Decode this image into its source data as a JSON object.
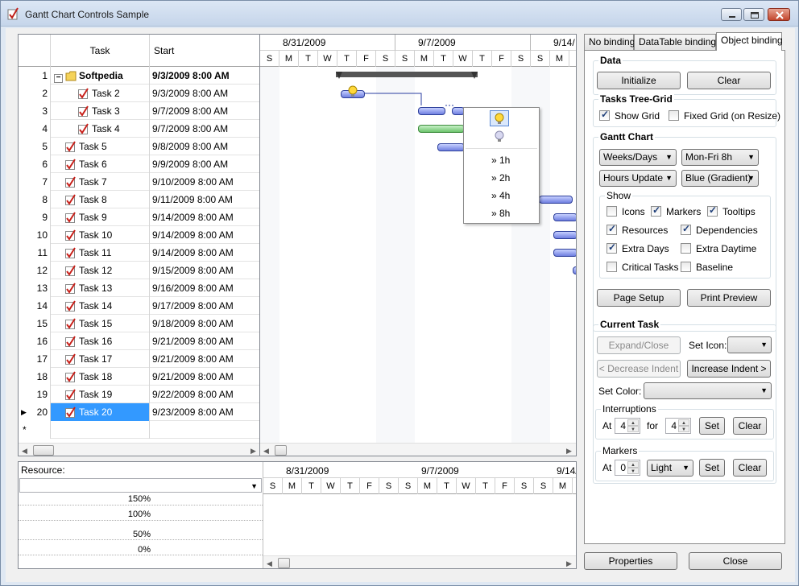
{
  "window": {
    "title": "Gantt Chart Controls Sample"
  },
  "grid": {
    "columns": [
      "Task",
      "Start"
    ],
    "rows": [
      {
        "num": "1",
        "task": "Softpedia",
        "start": "9/3/2009 8:00 AM",
        "bold": true,
        "icon": "folder"
      },
      {
        "num": "2",
        "task": "Task 2",
        "start": "9/3/2009 8:00 AM",
        "indent": 2
      },
      {
        "num": "3",
        "task": "Task 3",
        "start": "9/7/2009 8:00 AM",
        "indent": 2
      },
      {
        "num": "4",
        "task": "Task 4",
        "start": "9/7/2009 8:00 AM",
        "indent": 2
      },
      {
        "num": "5",
        "task": "Task 5",
        "start": "9/8/2009 8:00 AM"
      },
      {
        "num": "6",
        "task": "Task 6",
        "start": "9/9/2009 8:00 AM"
      },
      {
        "num": "7",
        "task": "Task 7",
        "start": "9/10/2009 8:00 AM"
      },
      {
        "num": "8",
        "task": "Task 8",
        "start": "9/11/2009 8:00 AM"
      },
      {
        "num": "9",
        "task": "Task 9",
        "start": "9/14/2009 8:00 AM"
      },
      {
        "num": "10",
        "task": "Task 10",
        "start": "9/14/2009 8:00 AM"
      },
      {
        "num": "11",
        "task": "Task 11",
        "start": "9/14/2009 8:00 AM"
      },
      {
        "num": "12",
        "task": "Task 12",
        "start": "9/15/2009 8:00 AM"
      },
      {
        "num": "13",
        "task": "Task 13",
        "start": "9/16/2009 8:00 AM"
      },
      {
        "num": "14",
        "task": "Task 14",
        "start": "9/17/2009 8:00 AM"
      },
      {
        "num": "15",
        "task": "Task 15",
        "start": "9/18/2009 8:00 AM"
      },
      {
        "num": "16",
        "task": "Task 16",
        "start": "9/21/2009 8:00 AM"
      },
      {
        "num": "17",
        "task": "Task 17",
        "start": "9/21/2009 8:00 AM"
      },
      {
        "num": "18",
        "task": "Task 18",
        "start": "9/21/2009 8:00 AM"
      },
      {
        "num": "19",
        "task": "Task 19",
        "start": "9/22/2009 8:00 AM"
      },
      {
        "num": "20",
        "task": "Task 20",
        "start": "9/23/2009 8:00 AM",
        "selected": true
      }
    ],
    "new_row_marker": "*",
    "current_row_marker": "▶"
  },
  "chart": {
    "weeks": [
      "8/31/2009",
      "9/7/2009",
      "9/14/"
    ],
    "days": [
      "S",
      "M",
      "T",
      "W",
      "T",
      "F",
      "S",
      "S",
      "M",
      "T",
      "W",
      "T",
      "F",
      "S",
      "S",
      "M",
      "T"
    ],
    "popup": {
      "items": [
        "» 1h",
        "» 2h",
        "» 4h",
        "» 8h"
      ]
    }
  },
  "resource": {
    "label": "Resource:",
    "levels": [
      "150%",
      "100%",
      "50%",
      "0%"
    ]
  },
  "tabs": [
    "No binding",
    "DataTable binding",
    "Object binding"
  ],
  "data_group": {
    "title": "Data",
    "initialize": "Initialize",
    "clear": "Clear"
  },
  "tree_grid": {
    "title": "Tasks Tree-Grid",
    "show_grid": "Show Grid",
    "show_grid_checked": true,
    "fixed_grid": "Fixed Grid (on Resize)",
    "fixed_grid_checked": false
  },
  "gantt": {
    "title": "Gantt Chart",
    "scale": "Weeks/Days",
    "schedule": "Mon-Fri 8h",
    "update": "Hours Update",
    "theme": "Blue (Gradient)",
    "show_title": "Show",
    "options": [
      {
        "label": "Icons",
        "checked": false
      },
      {
        "label": "Markers",
        "checked": true
      },
      {
        "label": "Tooltips",
        "checked": true
      },
      {
        "label": "Resources",
        "checked": true
      },
      {
        "label": "Dependencies",
        "checked": true
      },
      {
        "label": "Extra Days",
        "checked": true
      },
      {
        "label": "Extra Daytime",
        "checked": false
      },
      {
        "label": "Critical Tasks",
        "checked": false
      },
      {
        "label": "Baseline",
        "checked": false
      }
    ],
    "page_setup": "Page Setup",
    "print_preview": "Print Preview"
  },
  "current_task": {
    "title": "Current Task",
    "expand": "Expand/Close",
    "set_icon": "Set Icon:",
    "decrease": "< Decrease Indent",
    "increase": "Increase Indent >",
    "set_color": "Set Color:",
    "interruptions_title": "Interruptions",
    "at": "At",
    "at_value": "4",
    "for": "for",
    "for_value": "4",
    "set": "Set",
    "clear": "Clear",
    "markers_title": "Markers",
    "marker_at_value": "0",
    "marker_type": "Light",
    "marker_set": "Set",
    "marker_clear": "Clear"
  },
  "footer": {
    "properties": "Properties",
    "close": "Close"
  }
}
